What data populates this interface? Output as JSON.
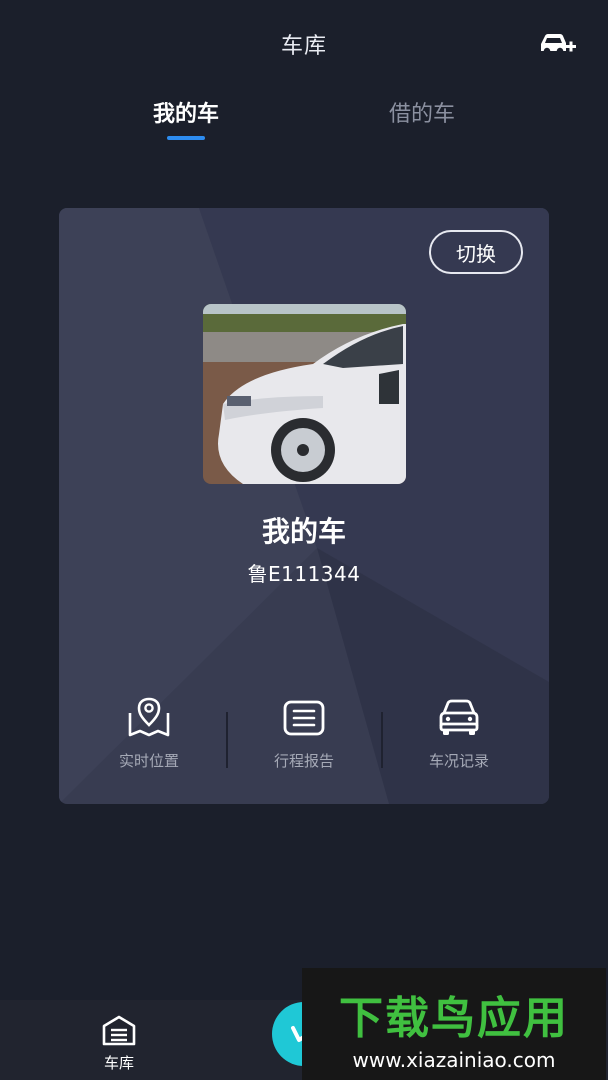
{
  "header": {
    "title": "车库"
  },
  "tabs": [
    {
      "label": "我的车",
      "active": true
    },
    {
      "label": "借的车",
      "active": false
    }
  ],
  "car_card": {
    "switch_label": "切换",
    "car_name": "我的车",
    "plate": "鲁E111344",
    "actions": [
      {
        "label": "实时位置",
        "icon": "map-pin-icon"
      },
      {
        "label": "行程报告",
        "icon": "trip-report-icon"
      },
      {
        "label": "车况记录",
        "icon": "car-icon"
      }
    ]
  },
  "bottom_nav": {
    "garage_label": "车库"
  },
  "watermark": {
    "logo_text": "下载鸟应用",
    "url": "www.xiazainiao.com"
  },
  "colors": {
    "background": "#1b1f2b",
    "card": "#383c51",
    "accent": "#2d8cf0",
    "center_button": "#1fc8d6",
    "watermark_green": "#40c040"
  }
}
